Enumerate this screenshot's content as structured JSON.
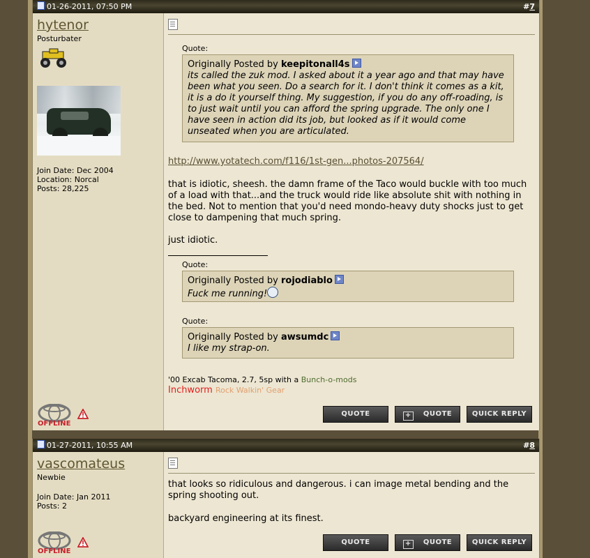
{
  "posts": [
    {
      "date": "01-26-2011, 07:50 PM",
      "number_prefix": "#",
      "number": "7",
      "user": {
        "name": "hytenor",
        "title": "Posturbater",
        "join": "Join Date: Dec 2004",
        "location": "Location: Norcal",
        "posts": "Posts: 28,225",
        "status": "offline"
      },
      "quote1": {
        "label": "Quote:",
        "prefix": "Originally Posted by",
        "author": "keepitonall4s",
        "text": "its called the zuk mod. I asked about it a year ago and that may have been what you seen. Do a search for it. I don't think it comes as a kit, it is a do it yourself thing. My suggestion, if you do any off-roading, is to just wait until you can afford the spring upgrade. The only one I have seen in action did its job, but looked as if it would come unseated when you are articulated."
      },
      "link": "http://www.yotatech.com/f116/1st-gen...photos-207564/",
      "body1": "that is idiotic, sheesh. the damn frame of the Taco would buckle with too much of a load with that...and the truck would ride like absolute shit with nothing in the bed. Not to mention that you'd need mondo-heavy duty shocks just to get close to dampening that much spring.",
      "body2": "just idiotic.",
      "sig_quote1": {
        "label": "Quote:",
        "prefix": "Originally Posted by",
        "author": "rojodiablo",
        "text": "Fuck me running!"
      },
      "sig_quote2": {
        "label": "Quote:",
        "prefix": "Originally Posted by",
        "author": "awsumdc",
        "text": "I like my strap-on."
      },
      "sig_line": "'00 Excab Tacoma, 2.7, 5sp with a",
      "sig_link": "Bunch-o-mods",
      "inchworm": "Inchworm",
      "inchworm_sub": "Rock Walkin' Gear"
    },
    {
      "date": "01-27-2011, 10:55 AM",
      "number_prefix": "#",
      "number": "8",
      "user": {
        "name": "vascomateus",
        "title": "Newbie",
        "join": "Join Date: Jan 2011",
        "posts": "Posts: 2",
        "status": "offline"
      },
      "body1": "that looks so ridiculous and dangerous. i can image metal bending and the spring shooting out.",
      "body2": "backyard engineering at its finest."
    }
  ],
  "buttons": {
    "quote": "QUOTE",
    "multi_quote": "QUOTE",
    "quick_reply": "QUICK REPLY"
  },
  "offline_label": "OFFLINE",
  "colors": {
    "header": "#2e2a1c",
    "user_pane": "#e4dcc2",
    "message_pane": "#ede6d2",
    "quote_box": "#ddd4b8",
    "username": "#5e5530",
    "inchworm": "#e02020"
  }
}
